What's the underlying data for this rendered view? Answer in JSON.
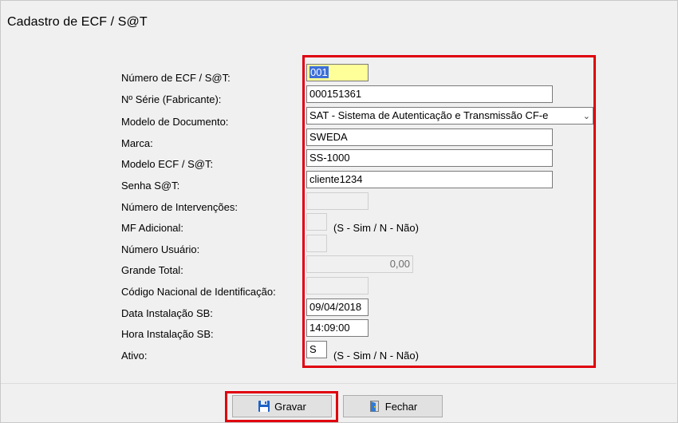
{
  "window": {
    "title": "Cadastro de ECF / S@T"
  },
  "form": {
    "numero_label": "Número de ECF / S@T:",
    "numero_value": "001",
    "serie_label": "Nº Série (Fabricante):",
    "serie_value": "000151361",
    "modelo_doc_label": "Modelo de Documento:",
    "modelo_doc_value": "SAT - Sistema de Autenticação e Transmissão CF-e",
    "marca_label": "Marca:",
    "marca_value": "SWEDA",
    "modelo_ecf_label": "Modelo ECF / S@T:",
    "modelo_ecf_value": "SS-1000",
    "senha_label": "Senha S@T:",
    "senha_value": "cliente1234",
    "intervencoes_label": "Número de Intervenções:",
    "intervencoes_value": "",
    "mf_label": "MF Adicional:",
    "mf_value": "",
    "mf_note": "(S - Sim / N - Não)",
    "usuario_label": "Número Usuário:",
    "usuario_value": "",
    "grande_total_label": "Grande Total:",
    "grande_total_value": "0,00",
    "codigo_label": "Código Nacional de Identificação:",
    "codigo_value": "",
    "data_label": "Data Instalação SB:",
    "data_value": "09/04/2018",
    "hora_label": "Hora Instalação SB:",
    "hora_value": "14:09:00",
    "ativo_label": "Ativo:",
    "ativo_value": "S",
    "ativo_note": "(S - Sim / N - Não)"
  },
  "buttons": {
    "save_label": "Gravar",
    "close_label": "Fechar"
  },
  "icons": {
    "save": "floppy-disk-icon",
    "close": "door-exit-icon"
  },
  "colors": {
    "highlight": "#e0000e",
    "selection": "#3d6fd8",
    "focus_bg": "#ffff99"
  }
}
